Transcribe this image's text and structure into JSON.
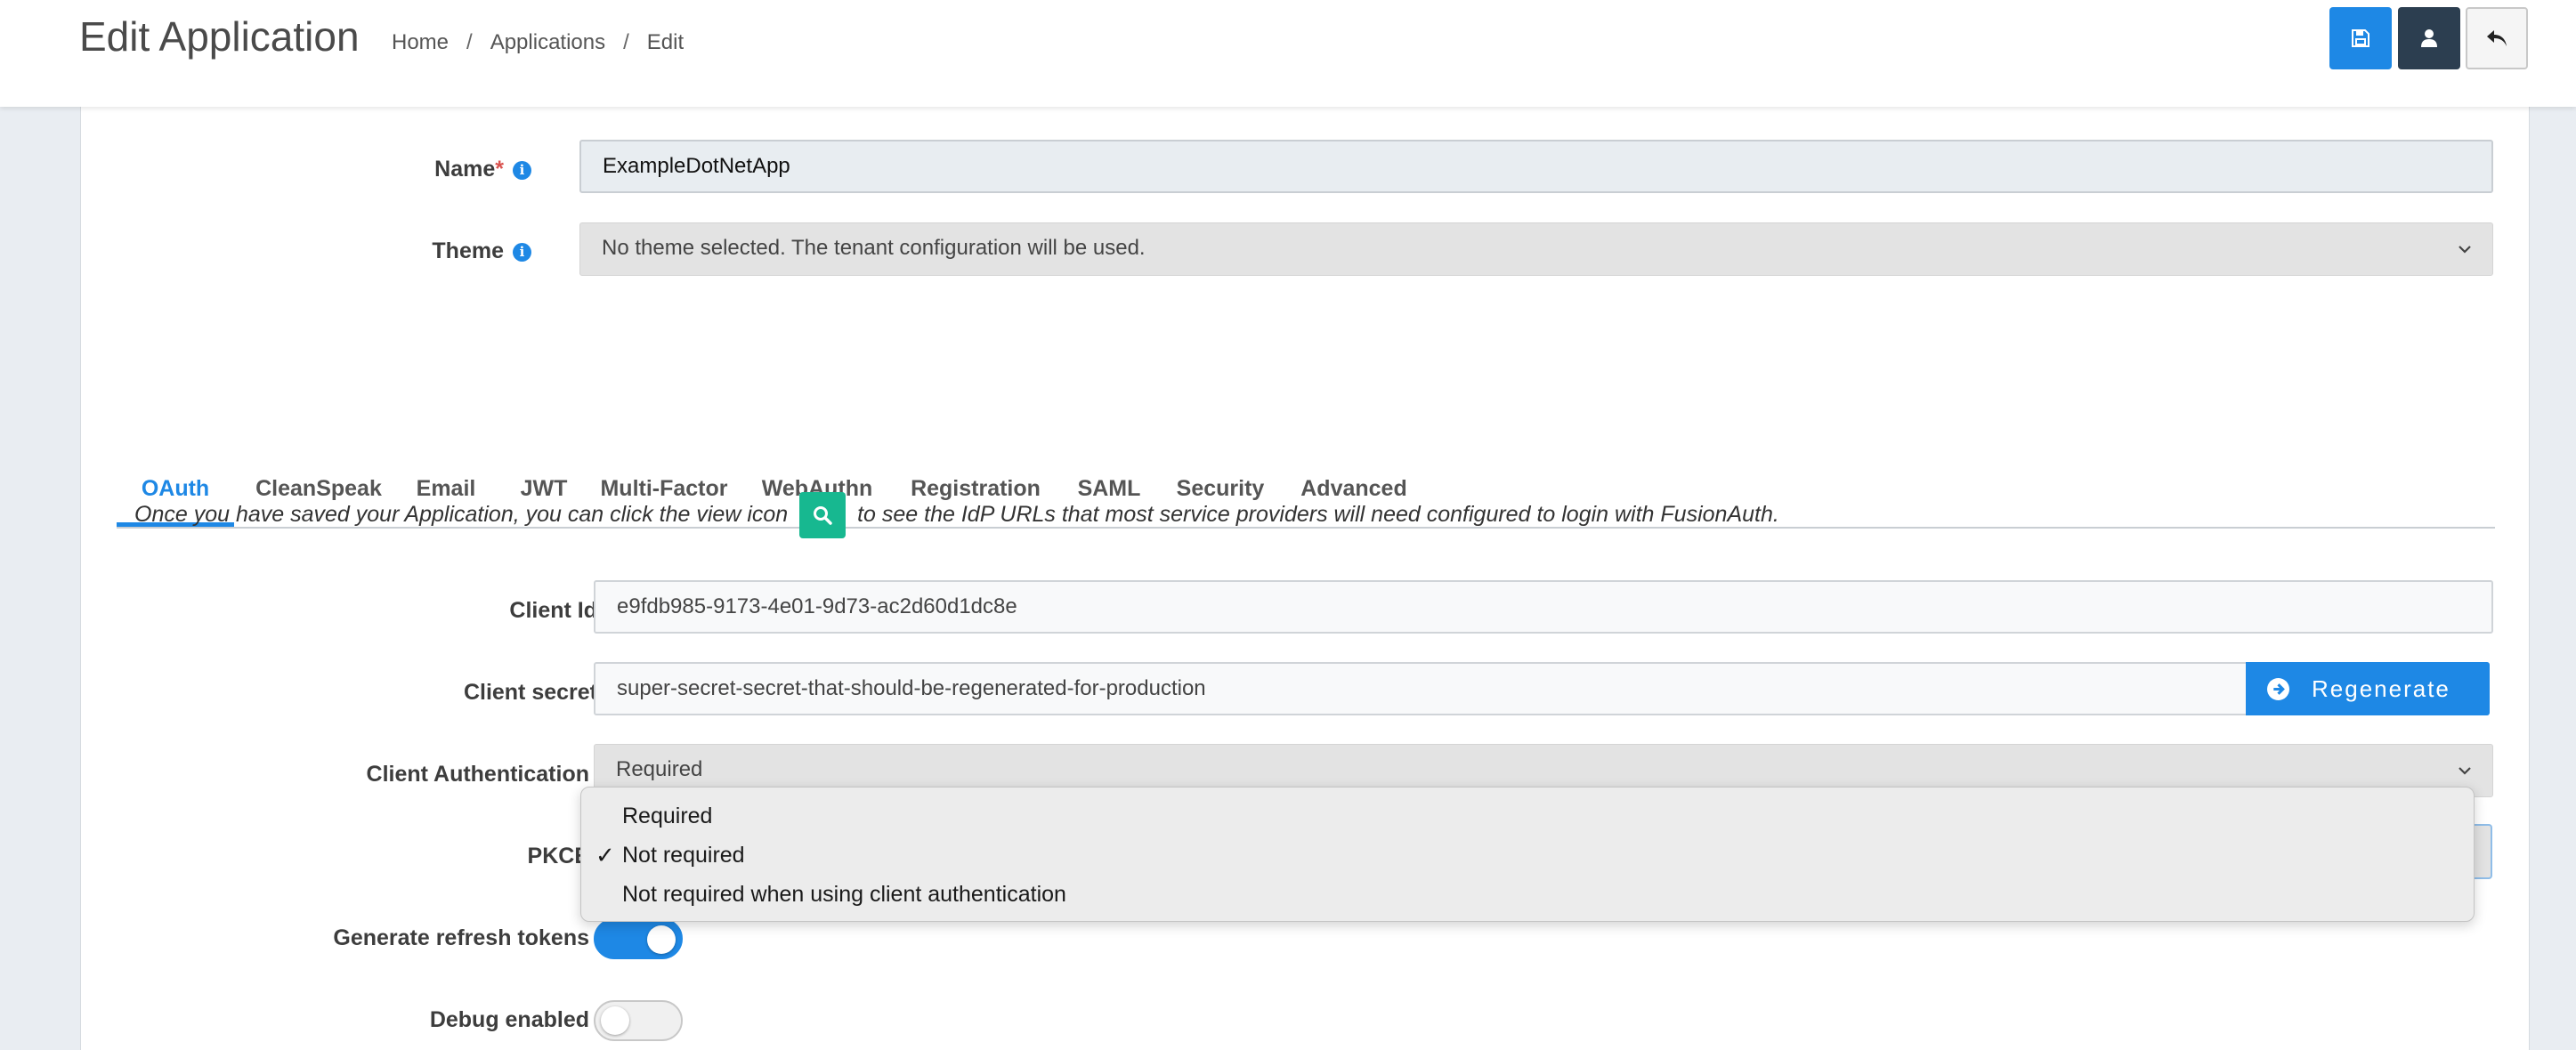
{
  "header": {
    "title": "Edit Application",
    "breadcrumb": [
      "Home",
      "Applications",
      "Edit"
    ],
    "buttons": {
      "save_icon": "save-icon",
      "user_icon": "user-icon",
      "back_icon": "reply-icon"
    }
  },
  "colors": {
    "primary": "#1e88e5",
    "dark": "#2c3e50",
    "view_icon": "#17b890",
    "required": "#d9534f"
  },
  "form": {
    "name": {
      "label": "Name",
      "required_mark": "*",
      "value": "ExampleDotNetApp"
    },
    "theme": {
      "label": "Theme",
      "value": "No theme selected. The tenant configuration will be used."
    }
  },
  "tabs": [
    "OAuth",
    "CleanSpeak",
    "Email",
    "JWT",
    "Multi-Factor",
    "WebAuthn",
    "Registration",
    "SAML",
    "Security",
    "Advanced"
  ],
  "active_tab": "OAuth",
  "oauth": {
    "notice_before": "Once you have saved your Application, you can click the view icon",
    "notice_after": "to see the IdP URLs that most service providers will need configured to login with FusionAuth.",
    "client_id": {
      "label": "Client Id",
      "value": "e9fdb985-9173-4e01-9d73-ac2d60d1dc8e"
    },
    "client_secret": {
      "label": "Client secret",
      "value": "super-secret-secret-that-should-be-regenerated-for-production",
      "regenerate_label": "Regenerate"
    },
    "client_authentication": {
      "label": "Client Authentication",
      "value": "Required"
    },
    "pkce": {
      "label": "PKCE",
      "options": [
        "Required",
        "Not required",
        "Not required when using client authentication"
      ],
      "selected": "Not required",
      "check_mark": "✓"
    },
    "generate_refresh_tokens": {
      "label": "Generate refresh tokens",
      "enabled": true
    },
    "debug_enabled": {
      "label": "Debug enabled",
      "enabled": false
    }
  }
}
